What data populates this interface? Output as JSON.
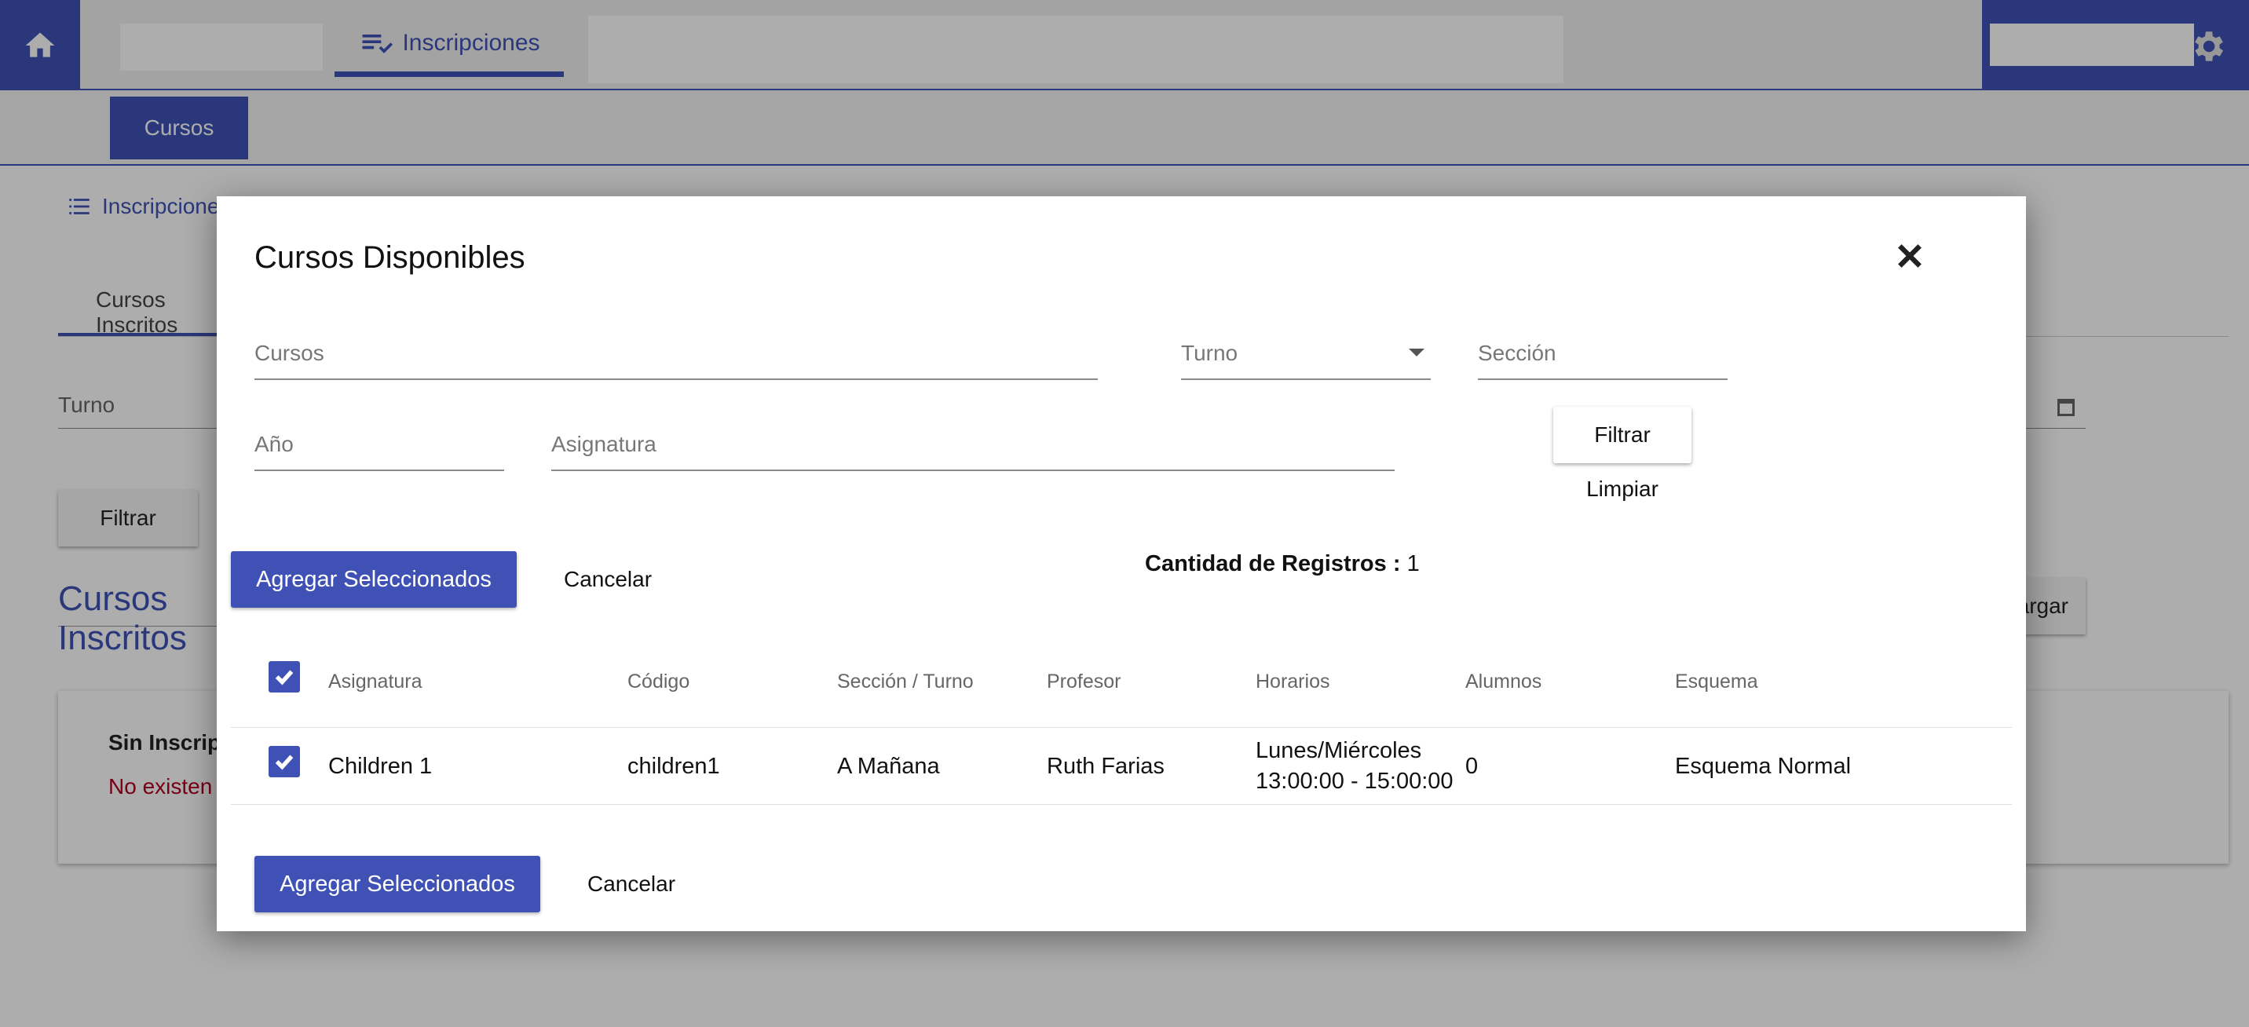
{
  "topbar": {
    "home_icon": "home-icon",
    "tab_label": "Inscripciones",
    "tab_icon": "playlist-check-icon",
    "settings_icon": "gear-icon"
  },
  "subnav": {
    "tab_label": "Cursos"
  },
  "background": {
    "breadcrumb": "Inscripciones",
    "tab_label": "Cursos Inscritos",
    "turno_label": "Turno",
    "filter_button": "Filtrar",
    "section_title": "Cursos Inscritos",
    "load_button": "Cargar",
    "empty_title": "Sin Inscripciones",
    "empty_message": "No existen inscripciones"
  },
  "modal": {
    "title": "Cursos Disponibles",
    "filters": {
      "cursos": "Cursos",
      "turno": "Turno",
      "seccion": "Sección",
      "anio": "Año",
      "asignatura": "Asignatura"
    },
    "filter_button": "Filtrar",
    "clear_button": "Limpiar",
    "add_selected": "Agregar Seleccionados",
    "cancel": "Cancelar",
    "count_label": "Cantidad de Registros :",
    "count_value": "1",
    "table": {
      "headers": [
        "Asignatura",
        "Código",
        "Sección / Turno",
        "Profesor",
        "Horarios",
        "Alumnos",
        "Esquema"
      ],
      "rows": [
        {
          "selected": true,
          "asignatura": "Children 1",
          "codigo": "children1",
          "seccion_turno": "A Mañana",
          "profesor": "Ruth Farias",
          "horario_dias": "Lunes/Miércoles",
          "horario_horas": "13:00:00 - 15:00:00",
          "alumnos": "0",
          "esquema": "Esquema Normal"
        }
      ]
    }
  },
  "colors": {
    "primary": "#3f51b5",
    "error": "#b00020"
  }
}
